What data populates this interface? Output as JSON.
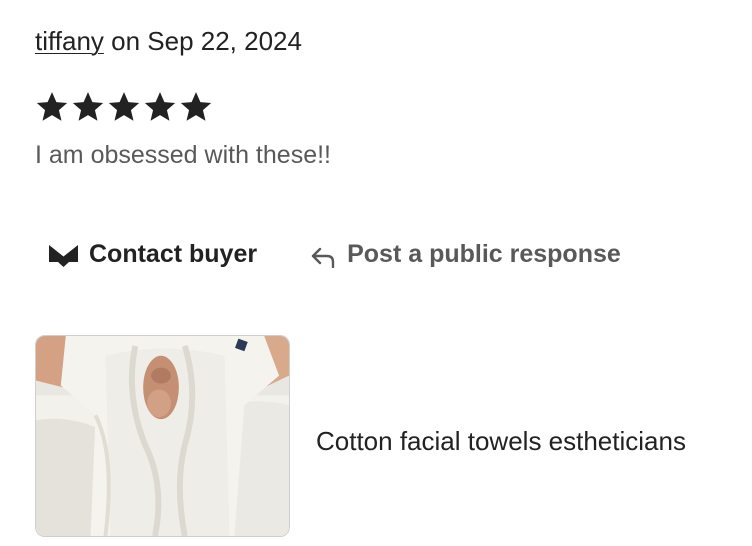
{
  "review": {
    "reviewer_name": "tiffany",
    "date_text": " on Sep 22, 2024",
    "rating": 5,
    "rating_max": 5,
    "text": "I am obsessed with these!!"
  },
  "actions": {
    "contact_label": "Contact buyer",
    "contact_icon": "envelope-icon",
    "respond_label": "Post a public response",
    "respond_icon": "reply-arrow-icon"
  },
  "product": {
    "title": "Cotton facial towels estheticians"
  },
  "colors": {
    "text_primary": "#222222",
    "text_secondary": "#595959",
    "star": "#222222"
  }
}
